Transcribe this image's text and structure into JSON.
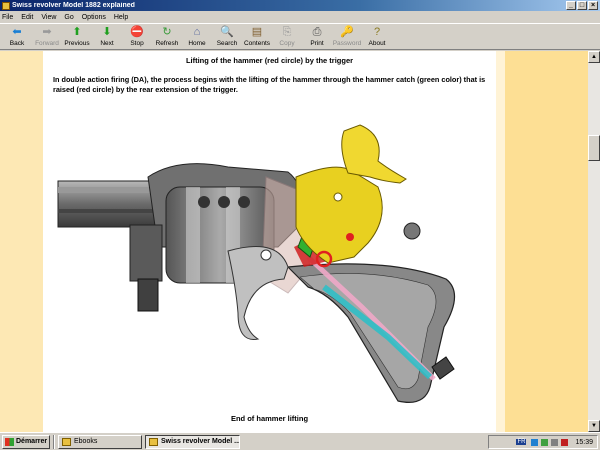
{
  "window": {
    "title": "Swiss revolver Model 1882 explained"
  },
  "menu": [
    "File",
    "Edit",
    "View",
    "Go",
    "Options",
    "Help"
  ],
  "toolbar": [
    {
      "label": "Back",
      "icon": "back-arrow-icon",
      "enabled": true,
      "color": "#1a7fd4"
    },
    {
      "label": "Forward",
      "icon": "forward-arrow-icon",
      "enabled": false,
      "color": "#9a9a9a"
    },
    {
      "label": "Previous",
      "icon": "up-arrow-icon",
      "enabled": true,
      "color": "#20a020"
    },
    {
      "label": "Next",
      "icon": "down-arrow-icon",
      "enabled": true,
      "color": "#20a020"
    },
    {
      "label": "Stop",
      "icon": "stop-icon",
      "enabled": true,
      "color": "#d02020"
    },
    {
      "label": "Refresh",
      "icon": "refresh-icon",
      "enabled": true,
      "color": "#3a9a3a"
    },
    {
      "label": "Home",
      "icon": "home-icon",
      "enabled": true,
      "color": "#5a6aa0"
    },
    {
      "label": "Search",
      "icon": "search-icon",
      "enabled": true,
      "color": "#606060"
    },
    {
      "label": "Contents",
      "icon": "contents-icon",
      "enabled": true,
      "color": "#806030"
    },
    {
      "label": "Copy",
      "icon": "copy-icon",
      "enabled": false,
      "color": "#9a9a9a"
    },
    {
      "label": "Print",
      "icon": "print-icon",
      "enabled": true,
      "color": "#505050"
    },
    {
      "label": "Password",
      "icon": "password-icon",
      "enabled": false,
      "color": "#9a9a9a"
    },
    {
      "label": "About",
      "icon": "about-icon",
      "enabled": true,
      "color": "#8a7a20"
    }
  ],
  "page": {
    "heading": "Lifting of the hammer (red circle) by the trigger",
    "paragraph": "In double action firing (DA), the process begins with the lifting of the hammer through the hammer catch (green color) that is raised (red circle) by the rear extension of the trigger.",
    "caption": "End of hammer lifting"
  },
  "taskbar": {
    "start_label": "Démarrer",
    "tasks": [
      {
        "label": "Ebooks",
        "active": false
      },
      {
        "label": "Swiss revolver Model ...",
        "active": true
      }
    ],
    "tray_lang": "FR",
    "clock": "15:39"
  },
  "colors": {
    "hammer": "#e8d020",
    "hammer_catch": "#30b030",
    "highlight": "#e02020",
    "frame": "#8a8a8a",
    "margin_left": "#fde8b4",
    "margin_right": "#fddf94"
  }
}
